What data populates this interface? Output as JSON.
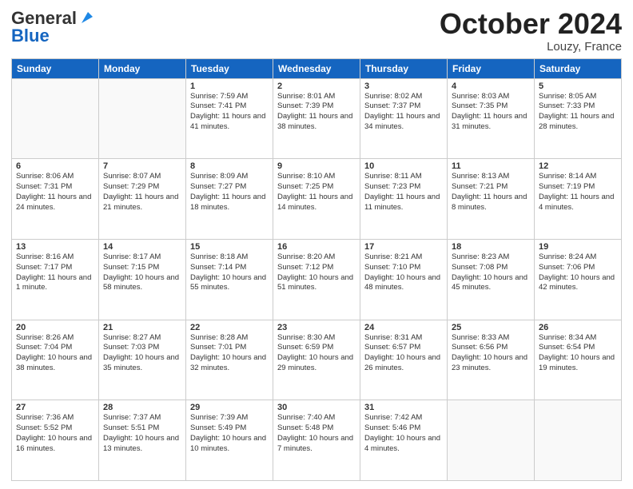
{
  "header": {
    "logo_line1": "General",
    "logo_line2": "Blue",
    "month": "October 2024",
    "location": "Louzy, France"
  },
  "days": [
    "Sunday",
    "Monday",
    "Tuesday",
    "Wednesday",
    "Thursday",
    "Friday",
    "Saturday"
  ],
  "weeks": [
    [
      {
        "day": "",
        "text": ""
      },
      {
        "day": "",
        "text": ""
      },
      {
        "day": "1",
        "text": "Sunrise: 7:59 AM\nSunset: 7:41 PM\nDaylight: 11 hours and 41 minutes."
      },
      {
        "day": "2",
        "text": "Sunrise: 8:01 AM\nSunset: 7:39 PM\nDaylight: 11 hours and 38 minutes."
      },
      {
        "day": "3",
        "text": "Sunrise: 8:02 AM\nSunset: 7:37 PM\nDaylight: 11 hours and 34 minutes."
      },
      {
        "day": "4",
        "text": "Sunrise: 8:03 AM\nSunset: 7:35 PM\nDaylight: 11 hours and 31 minutes."
      },
      {
        "day": "5",
        "text": "Sunrise: 8:05 AM\nSunset: 7:33 PM\nDaylight: 11 hours and 28 minutes."
      }
    ],
    [
      {
        "day": "6",
        "text": "Sunrise: 8:06 AM\nSunset: 7:31 PM\nDaylight: 11 hours and 24 minutes."
      },
      {
        "day": "7",
        "text": "Sunrise: 8:07 AM\nSunset: 7:29 PM\nDaylight: 11 hours and 21 minutes."
      },
      {
        "day": "8",
        "text": "Sunrise: 8:09 AM\nSunset: 7:27 PM\nDaylight: 11 hours and 18 minutes."
      },
      {
        "day": "9",
        "text": "Sunrise: 8:10 AM\nSunset: 7:25 PM\nDaylight: 11 hours and 14 minutes."
      },
      {
        "day": "10",
        "text": "Sunrise: 8:11 AM\nSunset: 7:23 PM\nDaylight: 11 hours and 11 minutes."
      },
      {
        "day": "11",
        "text": "Sunrise: 8:13 AM\nSunset: 7:21 PM\nDaylight: 11 hours and 8 minutes."
      },
      {
        "day": "12",
        "text": "Sunrise: 8:14 AM\nSunset: 7:19 PM\nDaylight: 11 hours and 4 minutes."
      }
    ],
    [
      {
        "day": "13",
        "text": "Sunrise: 8:16 AM\nSunset: 7:17 PM\nDaylight: 11 hours and 1 minute."
      },
      {
        "day": "14",
        "text": "Sunrise: 8:17 AM\nSunset: 7:15 PM\nDaylight: 10 hours and 58 minutes."
      },
      {
        "day": "15",
        "text": "Sunrise: 8:18 AM\nSunset: 7:14 PM\nDaylight: 10 hours and 55 minutes."
      },
      {
        "day": "16",
        "text": "Sunrise: 8:20 AM\nSunset: 7:12 PM\nDaylight: 10 hours and 51 minutes."
      },
      {
        "day": "17",
        "text": "Sunrise: 8:21 AM\nSunset: 7:10 PM\nDaylight: 10 hours and 48 minutes."
      },
      {
        "day": "18",
        "text": "Sunrise: 8:23 AM\nSunset: 7:08 PM\nDaylight: 10 hours and 45 minutes."
      },
      {
        "day": "19",
        "text": "Sunrise: 8:24 AM\nSunset: 7:06 PM\nDaylight: 10 hours and 42 minutes."
      }
    ],
    [
      {
        "day": "20",
        "text": "Sunrise: 8:26 AM\nSunset: 7:04 PM\nDaylight: 10 hours and 38 minutes."
      },
      {
        "day": "21",
        "text": "Sunrise: 8:27 AM\nSunset: 7:03 PM\nDaylight: 10 hours and 35 minutes."
      },
      {
        "day": "22",
        "text": "Sunrise: 8:28 AM\nSunset: 7:01 PM\nDaylight: 10 hours and 32 minutes."
      },
      {
        "day": "23",
        "text": "Sunrise: 8:30 AM\nSunset: 6:59 PM\nDaylight: 10 hours and 29 minutes."
      },
      {
        "day": "24",
        "text": "Sunrise: 8:31 AM\nSunset: 6:57 PM\nDaylight: 10 hours and 26 minutes."
      },
      {
        "day": "25",
        "text": "Sunrise: 8:33 AM\nSunset: 6:56 PM\nDaylight: 10 hours and 23 minutes."
      },
      {
        "day": "26",
        "text": "Sunrise: 8:34 AM\nSunset: 6:54 PM\nDaylight: 10 hours and 19 minutes."
      }
    ],
    [
      {
        "day": "27",
        "text": "Sunrise: 7:36 AM\nSunset: 5:52 PM\nDaylight: 10 hours and 16 minutes."
      },
      {
        "day": "28",
        "text": "Sunrise: 7:37 AM\nSunset: 5:51 PM\nDaylight: 10 hours and 13 minutes."
      },
      {
        "day": "29",
        "text": "Sunrise: 7:39 AM\nSunset: 5:49 PM\nDaylight: 10 hours and 10 minutes."
      },
      {
        "day": "30",
        "text": "Sunrise: 7:40 AM\nSunset: 5:48 PM\nDaylight: 10 hours and 7 minutes."
      },
      {
        "day": "31",
        "text": "Sunrise: 7:42 AM\nSunset: 5:46 PM\nDaylight: 10 hours and 4 minutes."
      },
      {
        "day": "",
        "text": ""
      },
      {
        "day": "",
        "text": ""
      }
    ]
  ]
}
